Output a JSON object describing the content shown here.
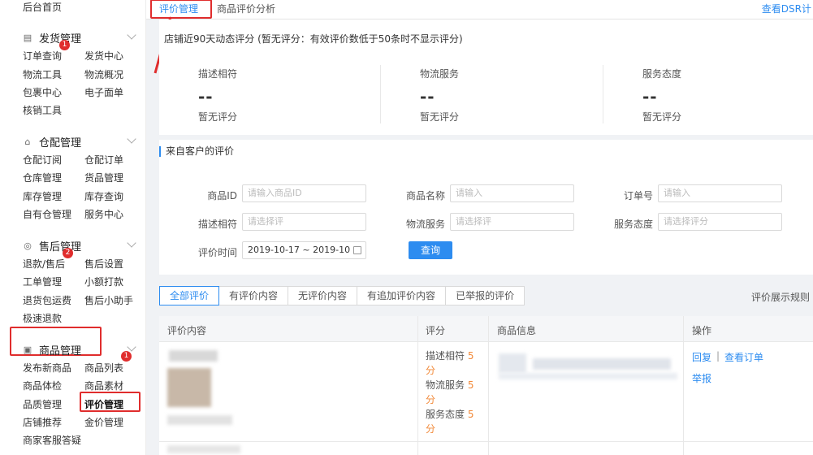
{
  "sidebar": {
    "home": "后台首页",
    "sections": [
      {
        "title": "发货管理",
        "badge": "1",
        "items": [
          "订单查询",
          "发货中心",
          "物流工具",
          "物流概况",
          "包裹中心",
          "电子面单",
          "核销工具"
        ]
      },
      {
        "title": "仓配管理",
        "items": [
          "仓配订阅",
          "仓配订单",
          "仓库管理",
          "货品管理",
          "库存管理",
          "库存查询",
          "自有仓管理",
          "服务中心"
        ]
      },
      {
        "title": "售后管理",
        "badge": "2",
        "items": [
          "退款/售后",
          "售后设置",
          "工单管理",
          "小额打款",
          "退货包运费",
          "售后小助手",
          "极速退款"
        ]
      },
      {
        "title": "商品管理",
        "badge": "1",
        "items": [
          "发布新商品",
          "商品列表",
          "商品体检",
          "商品素材",
          "品质管理",
          "评价管理",
          "店铺推荐",
          "金价管理",
          "商家客服答疑"
        ]
      }
    ]
  },
  "tabs": {
    "active": "评价管理",
    "second": "商品评价分析",
    "link": "查看DSR计"
  },
  "dsr": {
    "title": "店铺近90天动态评分 (暂无评分：有效评价数低于50条时不显示评分)",
    "cols": [
      {
        "label": "描述相符",
        "value": "--",
        "sub": "暂无评分"
      },
      {
        "label": "物流服务",
        "value": "--",
        "sub": "暂无评分"
      },
      {
        "label": "服务态度",
        "value": "--",
        "sub": "暂无评分"
      }
    ]
  },
  "filters": {
    "section_title": "来自客户的评价",
    "product_id_label": "商品ID",
    "product_id_ph": "请输入商品ID",
    "product_name_label": "商品名称",
    "product_name_ph": "请输入",
    "order_label": "订单号",
    "order_ph": "请输入",
    "desc_label": "描述相符",
    "desc_ph": "请选择评",
    "logistics_label": "物流服务",
    "logistics_ph": "请选择评",
    "service_label": "服务态度",
    "service_ph": "请选择评分",
    "time_label": "评价时间",
    "time_value": "2019-10-17 ~ 2019-10",
    "query_btn": "查询"
  },
  "review_tabs": [
    "全部评价",
    "有评价内容",
    "无评价内容",
    "有追加评价内容",
    "已举报的评价"
  ],
  "rule_link": "评价展示规则",
  "table": {
    "headers": [
      "评价内容",
      "评分",
      "商品信息",
      "操作"
    ],
    "row": {
      "scores": [
        {
          "label": "描述相符",
          "num": "5",
          "unit": "分"
        },
        {
          "label": "物流服务",
          "num": "5",
          "unit": "分"
        },
        {
          "label": "服务态度",
          "num": "5",
          "unit": "分"
        }
      ],
      "reply": "回复",
      "sep": "|",
      "view_order": "查看订单",
      "report": "举报"
    }
  }
}
